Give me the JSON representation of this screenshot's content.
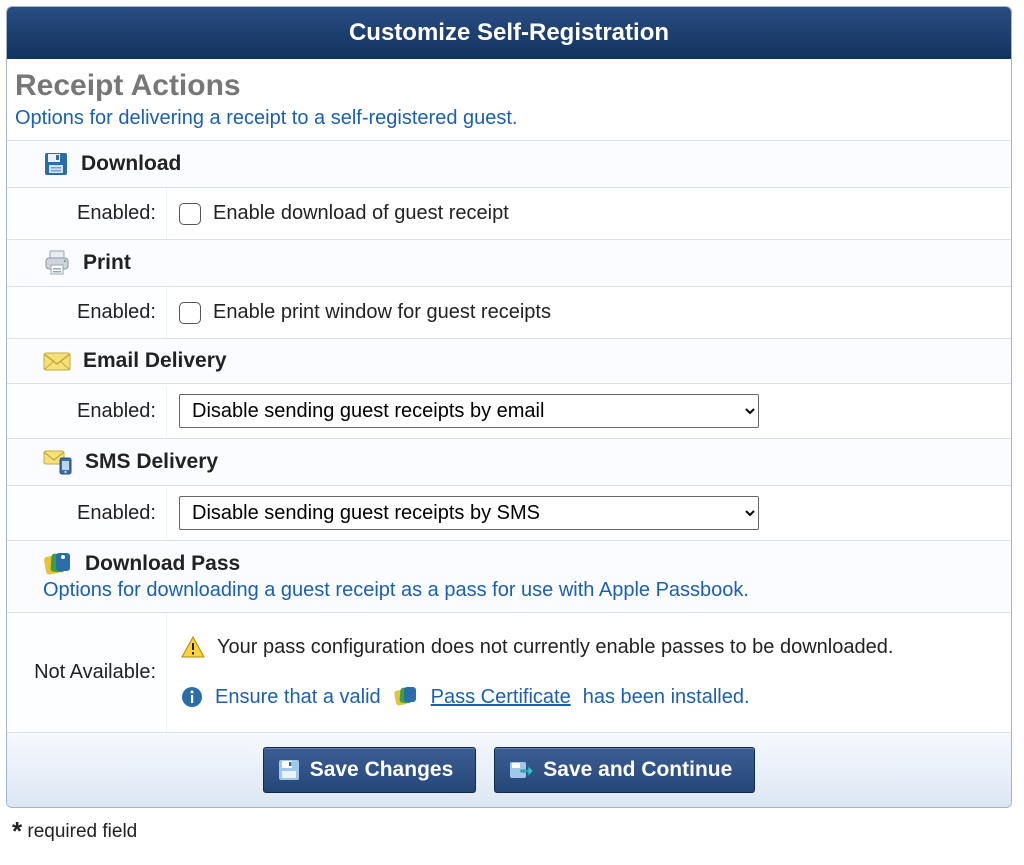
{
  "header": {
    "title": "Customize Self-Registration"
  },
  "section": {
    "title": "Receipt Actions",
    "desc": "Options for delivering a receipt to a self-registered guest."
  },
  "download": {
    "title": "Download",
    "label": "Enabled:",
    "checkbox_text": "Enable download of guest receipt"
  },
  "print": {
    "title": "Print",
    "label": "Enabled:",
    "checkbox_text": "Enable print window for guest receipts"
  },
  "email": {
    "title": "Email Delivery",
    "label": "Enabled:",
    "select_value": "Disable sending guest receipts by email"
  },
  "sms": {
    "title": "SMS Delivery",
    "label": "Enabled:",
    "select_value": "Disable sending guest receipts by SMS"
  },
  "pass": {
    "title": "Download Pass",
    "desc": "Options for downloading a guest receipt as a pass for use with Apple Passbook.",
    "label": "Not Available:",
    "warn_text": "Your pass configuration does not currently enable passes to be downloaded.",
    "info_prefix": "Ensure that a valid",
    "info_link": "Pass Certificate",
    "info_suffix": "has been installed."
  },
  "buttons": {
    "save": "Save Changes",
    "save_continue": "Save and Continue"
  },
  "required_note": "required field"
}
